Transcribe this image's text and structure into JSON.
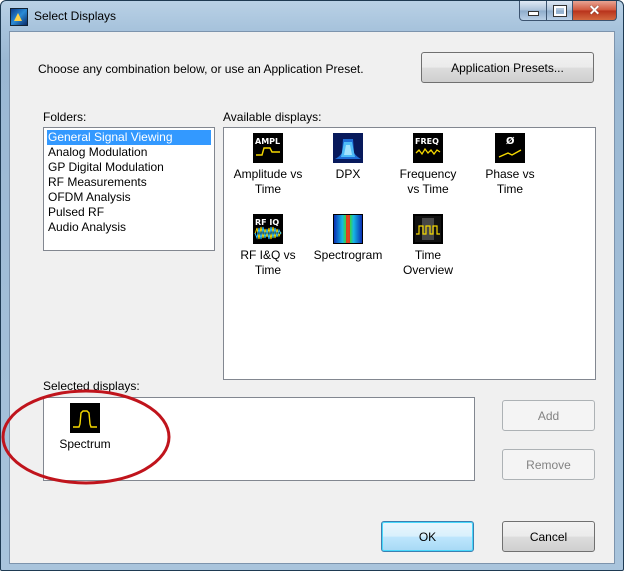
{
  "window": {
    "title": "Select Displays"
  },
  "instructions": "Choose any combination below, or use an Application Preset.",
  "buttons": {
    "presets": "Application Presets...",
    "add": "Add",
    "remove": "Remove",
    "ok": "OK",
    "cancel": "Cancel"
  },
  "folders": {
    "label": "Folders:",
    "items": [
      "General Signal Viewing",
      "Analog Modulation",
      "GP Digital Modulation",
      "RF Measurements",
      "OFDM Analysis",
      "Pulsed RF",
      "Audio Analysis"
    ],
    "selected": "General Signal Viewing"
  },
  "available": {
    "label": "Available displays:",
    "items": [
      {
        "line1": "Amplitude vs",
        "line2": "Time",
        "tag": "AMPL",
        "icon": "amplitude-time-icon"
      },
      {
        "line1": "DPX",
        "line2": "",
        "tag": "",
        "icon": "dpx-icon"
      },
      {
        "line1": "Frequency",
        "line2": "vs Time",
        "tag": "FREQ",
        "icon": "frequency-time-icon"
      },
      {
        "line1": "Phase vs",
        "line2": "Time",
        "tag": "Ø",
        "icon": "phase-time-icon"
      },
      {
        "line1": "RF I&Q vs",
        "line2": "Time",
        "tag": "RF IQ",
        "icon": "rf-iq-time-icon"
      },
      {
        "line1": "Spectrogram",
        "line2": "",
        "tag": "",
        "icon": "spectrogram-icon"
      },
      {
        "line1": "Time",
        "line2": "Overview",
        "tag": "",
        "icon": "time-overview-icon"
      }
    ]
  },
  "selected": {
    "label": "Selected displays:",
    "items": [
      {
        "label": "Spectrum",
        "icon": "spectrum-icon"
      }
    ]
  },
  "colors": {
    "accent": "#3399ff",
    "annotation": "#c0141c",
    "trace": "#f5d800"
  }
}
